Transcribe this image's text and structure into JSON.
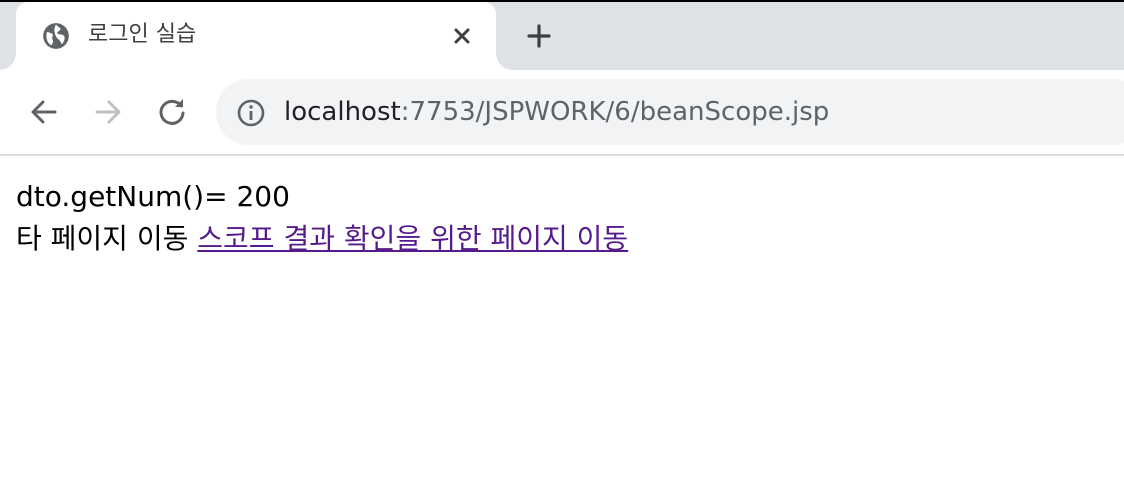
{
  "browser": {
    "tab": {
      "title": "로그인 실습",
      "favicon": "globe-icon"
    },
    "address": {
      "host": "localhost",
      "path": ":7753/JSPWORK/6/beanScope.jsp"
    },
    "icons": [
      "back-arrow-icon",
      "forward-arrow-icon",
      "reload-icon",
      "info-icon",
      "close-icon",
      "plus-icon"
    ]
  },
  "page": {
    "line1": {
      "label": "dto.getNum()=",
      "value": "200"
    },
    "line2": {
      "text": "타 페이지 이동",
      "link": "스코프 결과 확인을 위한 페이지 이동"
    }
  },
  "colors": {
    "link_visited": "#551a8b",
    "tabstrip": "#dee1e6",
    "omnibox": "#f1f3f4"
  }
}
